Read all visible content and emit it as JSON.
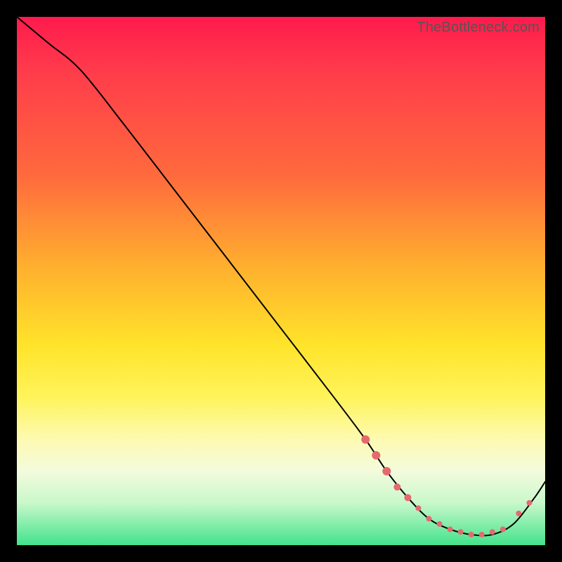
{
  "watermark": "TheBottleneck.com",
  "chart_data": {
    "type": "line",
    "title": "",
    "xlabel": "",
    "ylabel": "",
    "xlim": [
      0,
      100
    ],
    "ylim": [
      0,
      100
    ],
    "grid": false,
    "legend": false,
    "series": [
      {
        "name": "curve",
        "x": [
          0,
          6,
          12,
          20,
          30,
          40,
          50,
          60,
          66,
          70,
          74,
          78,
          82,
          86,
          90,
          94,
          98,
          100
        ],
        "y": [
          100,
          95,
          90,
          80,
          67,
          54,
          41,
          28,
          20,
          14,
          9,
          5,
          3,
          2,
          2,
          4,
          9,
          12
        ],
        "color": "#000000"
      }
    ],
    "markers": [
      {
        "x": 66,
        "y": 20,
        "r": 6
      },
      {
        "x": 68,
        "y": 17,
        "r": 6
      },
      {
        "x": 70,
        "y": 14,
        "r": 6
      },
      {
        "x": 72,
        "y": 11,
        "r": 5
      },
      {
        "x": 74,
        "y": 9,
        "r": 5
      },
      {
        "x": 76,
        "y": 7,
        "r": 4
      },
      {
        "x": 78,
        "y": 5,
        "r": 4
      },
      {
        "x": 80,
        "y": 4,
        "r": 4
      },
      {
        "x": 82,
        "y": 3,
        "r": 4
      },
      {
        "x": 84,
        "y": 2.5,
        "r": 4
      },
      {
        "x": 86,
        "y": 2,
        "r": 4
      },
      {
        "x": 88,
        "y": 2,
        "r": 4
      },
      {
        "x": 90,
        "y": 2.5,
        "r": 4
      },
      {
        "x": 92,
        "y": 3,
        "r": 4
      },
      {
        "x": 95,
        "y": 6,
        "r": 4
      },
      {
        "x": 97,
        "y": 8,
        "r": 4
      }
    ],
    "marker_color": "#e46a6f"
  }
}
